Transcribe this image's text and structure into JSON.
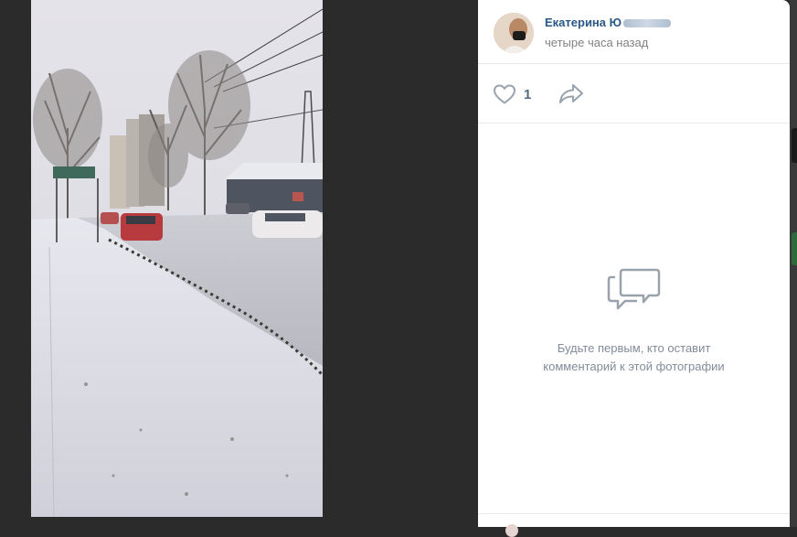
{
  "post": {
    "author_name": "Екатерина Ю",
    "time": "четыре часа назад",
    "likes": "1"
  },
  "comments": {
    "empty_line1": "Будьте первым, кто оставит",
    "empty_line2": "комментарий к этой фотографии"
  },
  "icons": {
    "like": "heart-icon",
    "share": "share-arrow-icon",
    "comments": "comment-bubbles-icon"
  },
  "colors": {
    "link": "#2a5885",
    "muted": "#818c99",
    "icon": "#99a2ad",
    "backdrop": "#2b2b2c"
  }
}
